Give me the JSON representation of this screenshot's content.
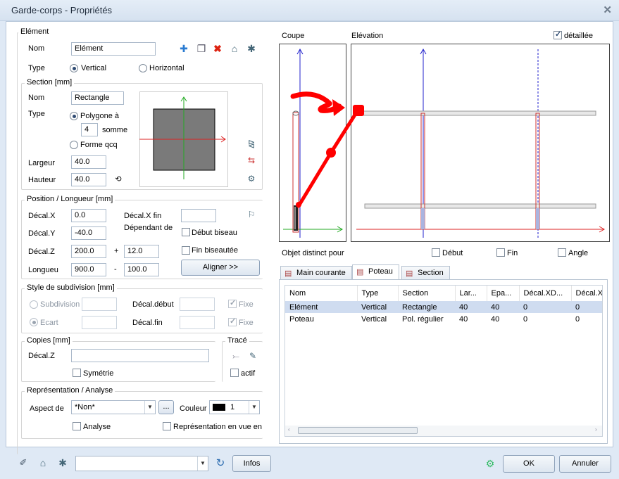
{
  "window": {
    "title": "Garde-corps - Propriétés",
    "close_glyph": "✕"
  },
  "element": {
    "group_label": "Elément",
    "nom_label": "Nom",
    "nom_value": "Elément",
    "type_label": "Type",
    "vertical_label": "Vertical",
    "horizontal_label": "Horizontal",
    "toolbar_icons": [
      "add-icon",
      "copy-icon",
      "delete-icon",
      "open-folder-icon",
      "save-favorite-icon"
    ]
  },
  "section": {
    "group_label": "Section  [mm]",
    "nom_label": "Nom",
    "nom_value": "Rectangle",
    "type_label": "Type",
    "polygone_label": "Polygone à",
    "sommets_value": "4",
    "sommets_label": "somme",
    "forme_label": "Forme qcq",
    "largeur_label": "Largeur",
    "largeur_value": "40.0",
    "hauteur_label": "Hauteur",
    "hauteur_value": "40.0"
  },
  "position": {
    "group_label": "Position / Longueur [mm]",
    "decalx_label": "Décal.X",
    "decalx_value": "0.0",
    "decalxfin_label": "Décal.X fin",
    "decalxfin_value": "",
    "decaly_label": "Décal.Y",
    "decaly_value": "-40.0",
    "dependant_label": "Dépendant de",
    "debut_biseau_label": "Début biseau",
    "decalz_label": "Décal.Z",
    "decalz_value": "200.0",
    "plus": "+",
    "decalz_plus_value": "12.0",
    "fin_biseau_label": "Fin biseautée",
    "longueur_label": "Longueu",
    "longueur_value": "900.0",
    "minus": "-",
    "longueur_minus_value": "100.0",
    "aligner_label": "Aligner >>"
  },
  "subdivision": {
    "group_label": "Style de subdivision [mm]",
    "subdivision_label": "Subdivision",
    "ecart_label": "Ecart",
    "decal_debut_label": "Décal.début",
    "decal_fin_label": "Décal.fin",
    "fixe_label": "Fixe"
  },
  "copies": {
    "group_label": "Copies  [mm]",
    "decalz_label": "Décal.Z",
    "symetrie_label": "Symétrie"
  },
  "trace": {
    "group_label": "Tracé",
    "actif_label": "actif"
  },
  "representation": {
    "group_label": "Représentation / Analyse",
    "aspect_label": "Aspect de",
    "aspect_value": "*Non*",
    "ellipsis": "...",
    "couleur_label": "Couleur",
    "couleur_value": "1",
    "analyse_label": "Analyse",
    "repr_vue_label": "Représentation en vue en"
  },
  "views": {
    "coupe_label": "Coupe",
    "elevation_label": "Elévation",
    "detaillee_label": "détaillée",
    "objet_distinct_label": "Objet distinct pour",
    "debut_label": "Début",
    "fin_label": "Fin",
    "angle_label": "Angle"
  },
  "tabs": [
    {
      "label": "Main courante",
      "active": false
    },
    {
      "label": "Poteau",
      "active": true
    },
    {
      "label": "Section",
      "active": false
    }
  ],
  "table": {
    "columns": [
      "Nom",
      "Type",
      "Section",
      "Lar...",
      "Epa...",
      "Décal.XD...",
      "Décal.X"
    ],
    "rows": [
      [
        "Elément",
        "Vertical",
        "Rectangle",
        "40",
        "40",
        "0",
        "0"
      ],
      [
        "Poteau",
        "Vertical",
        "Pol. régulier",
        "40",
        "40",
        "0",
        "0"
      ]
    ]
  },
  "footer": {
    "infos_label": "Infos",
    "ok_label": "OK",
    "annuler_label": "Annuler"
  },
  "colors": {
    "accent": "#2f4b73",
    "red_axis": "#d22",
    "green_axis": "#2a2",
    "blue_axis": "#22c",
    "annotation": "#f00"
  }
}
